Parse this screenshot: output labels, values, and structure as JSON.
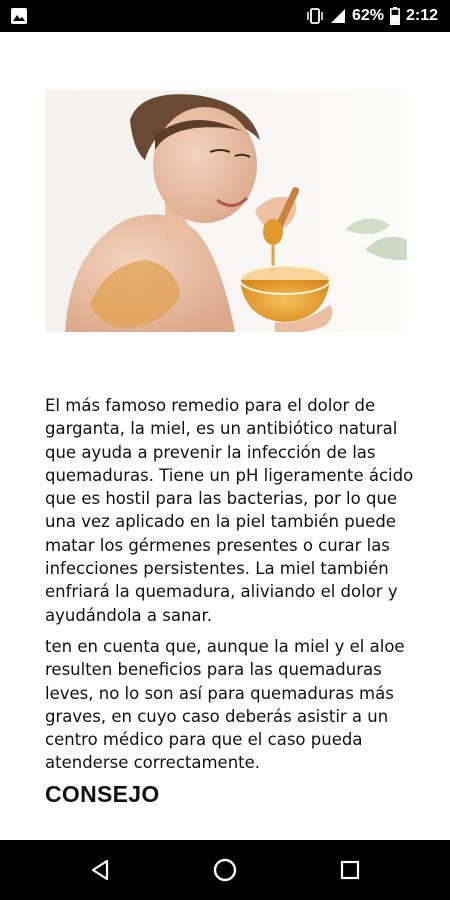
{
  "status_bar": {
    "battery_percent": "62%",
    "time": "2:12",
    "icons": [
      "image-notification-icon",
      "vibrate-icon",
      "signal-icon",
      "battery-icon"
    ]
  },
  "hero_image": {
    "subject": "woman-with-honey-bowl-photo"
  },
  "article": {
    "paragraphs": [
      "El más famoso remedio para el dolor de garganta, la miel, es un antibiótico natural que ayuda a prevenir la infección de las quemaduras. Tiene un pH ligeramente ácido que es hostil para las bacterias, por lo que una vez aplicado en la piel también puede matar los gérmenes presentes o curar las infecciones persistentes. La miel también enfriará la quemadura, aliviando el dolor y ayudándola a sanar.",
      "ten en cuenta que, aunque la miel y el aloe resulten beneficios para las quemaduras leves, no lo son así para quemaduras más graves, en cuyo caso deberás asistir a un centro médico para que el caso pueda atenderse correctamente."
    ],
    "heading": "CONSEJO"
  },
  "nav_bar": {
    "buttons": [
      "back-icon",
      "home-icon",
      "recents-icon"
    ]
  },
  "colors": {
    "bar_background": "#000000",
    "text": "#111111",
    "honey": "#e8a13a"
  }
}
